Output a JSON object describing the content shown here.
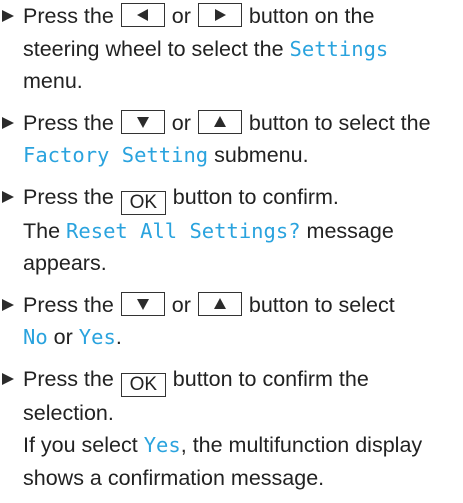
{
  "colors": {
    "display_text": "#2aa3de",
    "body_text": "#222222"
  },
  "steps": [
    {
      "pre": "Press the",
      "key1_icon": "left-arrow-key",
      "mid": "or",
      "key2_icon": "right-arrow-key",
      "post": "button on the",
      "line2_pre": "steering wheel to select the",
      "highlight": "Settings",
      "line3": "menu."
    },
    {
      "pre": "Press the",
      "key1_icon": "down-arrow-key",
      "mid": "or",
      "key2_icon": "up-arrow-key",
      "post": "button to select the",
      "highlight": "Factory Setting",
      "line2_post": "submenu."
    },
    {
      "pre": "Press the",
      "key_label": "OK",
      "post": "button to confirm.",
      "line2_pre": "The",
      "highlight": "Reset All Settings?",
      "line2_post": "message",
      "line3": "appears."
    },
    {
      "pre": "Press the",
      "key1_icon": "down-arrow-key",
      "mid": "or",
      "key2_icon": "up-arrow-key",
      "post": "button to select",
      "highlight_no": "No",
      "line2_mid": "or",
      "highlight_yes": "Yes",
      "line2_end": "."
    },
    {
      "pre": "Press the",
      "key_label": "OK",
      "post": "button to confirm the",
      "line2": "selection.",
      "line3_pre": "If you select",
      "highlight": "Yes",
      "line3_post": ", the multifunction display",
      "line4": "shows a confirmation message."
    }
  ]
}
